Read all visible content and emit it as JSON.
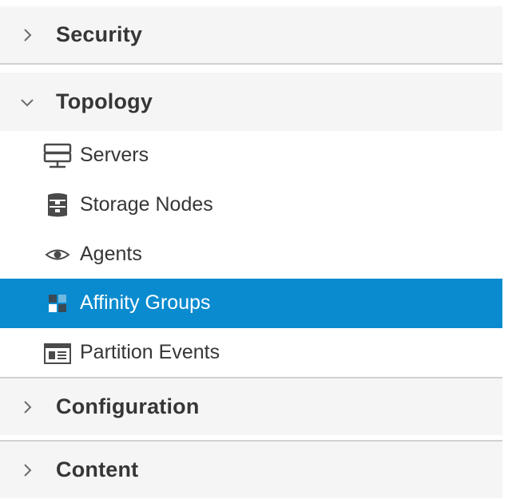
{
  "nav": {
    "sections": [
      {
        "label": "Security",
        "expanded": false,
        "icon": "chevron-right-icon"
      },
      {
        "label": "Topology",
        "expanded": true,
        "icon": "chevron-down-icon"
      },
      {
        "label": "Configuration",
        "expanded": false,
        "icon": "chevron-right-icon"
      },
      {
        "label": "Content",
        "expanded": false,
        "icon": "chevron-right-icon"
      }
    ],
    "topology_items": [
      {
        "label": "Servers",
        "icon": "server-icon",
        "active": false
      },
      {
        "label": "Storage Nodes",
        "icon": "storage-node-icon",
        "active": false
      },
      {
        "label": "Agents",
        "icon": "eye-icon",
        "active": false
      },
      {
        "label": "Affinity Groups",
        "icon": "affinity-groups-icon",
        "active": true
      },
      {
        "label": "Partition Events",
        "icon": "partition-events-icon",
        "active": false
      }
    ]
  },
  "colors": {
    "active_background": "#0a8bcf",
    "active_text": "#ffffff",
    "header_background": "#f5f5f5",
    "text": "#363636",
    "divider": "#d1d1d1"
  }
}
